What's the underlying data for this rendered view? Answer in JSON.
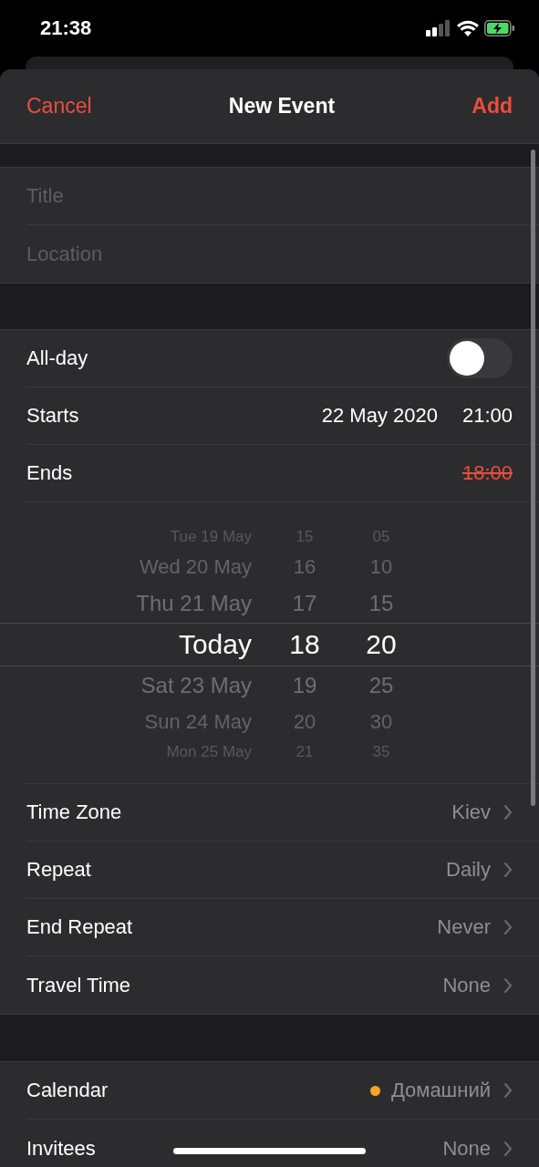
{
  "status_bar": {
    "time": "21:38"
  },
  "nav": {
    "cancel": "Cancel",
    "title": "New Event",
    "add": "Add"
  },
  "fields": [
    {
      "placeholder": "Title"
    },
    {
      "placeholder": "Location"
    }
  ],
  "all_day": {
    "label": "All-day",
    "on": false
  },
  "starts": {
    "label": "Starts",
    "date": "22 May 2020",
    "time": "21:00"
  },
  "ends": {
    "label": "Ends",
    "time": "18:00",
    "invalid": true
  },
  "picker": {
    "rows": [
      {
        "date": "Tue 19 May",
        "hour": "15",
        "minute": "05",
        "selected": false
      },
      {
        "date": "Wed 20 May",
        "hour": "16",
        "minute": "10",
        "selected": false
      },
      {
        "date": "Thu 21 May",
        "hour": "17",
        "minute": "15",
        "selected": false
      },
      {
        "date": "Today",
        "hour": "18",
        "minute": "20",
        "selected": true
      },
      {
        "date": "Sat 23 May",
        "hour": "19",
        "minute": "25",
        "selected": false
      },
      {
        "date": "Sun 24 May",
        "hour": "20",
        "minute": "30",
        "selected": false
      },
      {
        "date": "Mon 25 May",
        "hour": "21",
        "minute": "35",
        "selected": false
      }
    ]
  },
  "options": [
    {
      "label": "Time Zone",
      "value": "Kiev"
    },
    {
      "label": "Repeat",
      "value": "Daily"
    },
    {
      "label": "End Repeat",
      "value": "Never"
    },
    {
      "label": "Travel Time",
      "value": "None"
    }
  ],
  "more": [
    {
      "label": "Calendar",
      "value": "Домашний",
      "color": "#f5a623"
    },
    {
      "label": "Invitees",
      "value": "None"
    }
  ]
}
